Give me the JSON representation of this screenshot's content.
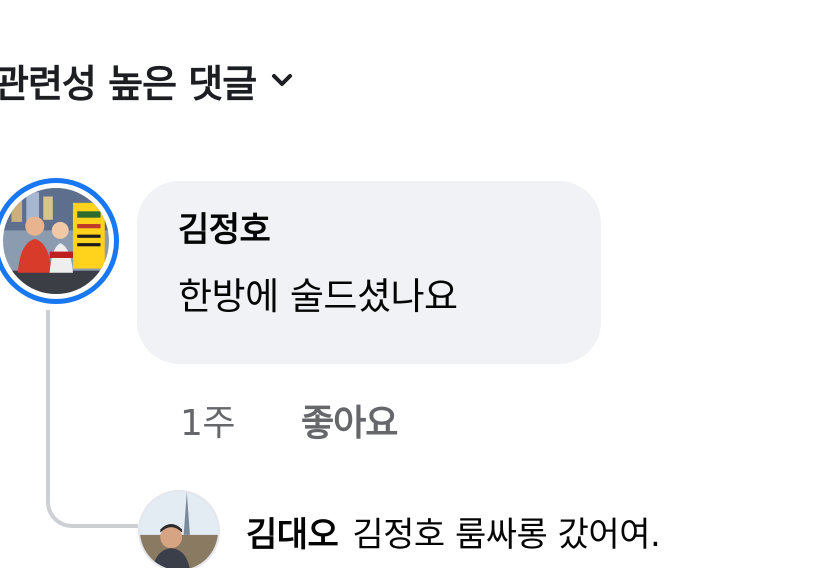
{
  "sort": {
    "label": "관련성 높은 댓글",
    "icon": "chevron-down-icon"
  },
  "comment": {
    "author": "김정호",
    "text": "한방에 술드셨나요",
    "time": "1주",
    "like_label": "좋아요",
    "avatar": "profile-photo-icon",
    "avatar_ring_color": "#1877f2"
  },
  "reply": {
    "author": "김대오",
    "text": "김정호 룸싸롱 갔어여.",
    "avatar": "profile-photo-icon"
  },
  "colors": {
    "bubble_bg": "#f0f2f5",
    "meta_text": "#65676b",
    "thread_line": "#ccd0d5",
    "primary_text": "#050505"
  }
}
